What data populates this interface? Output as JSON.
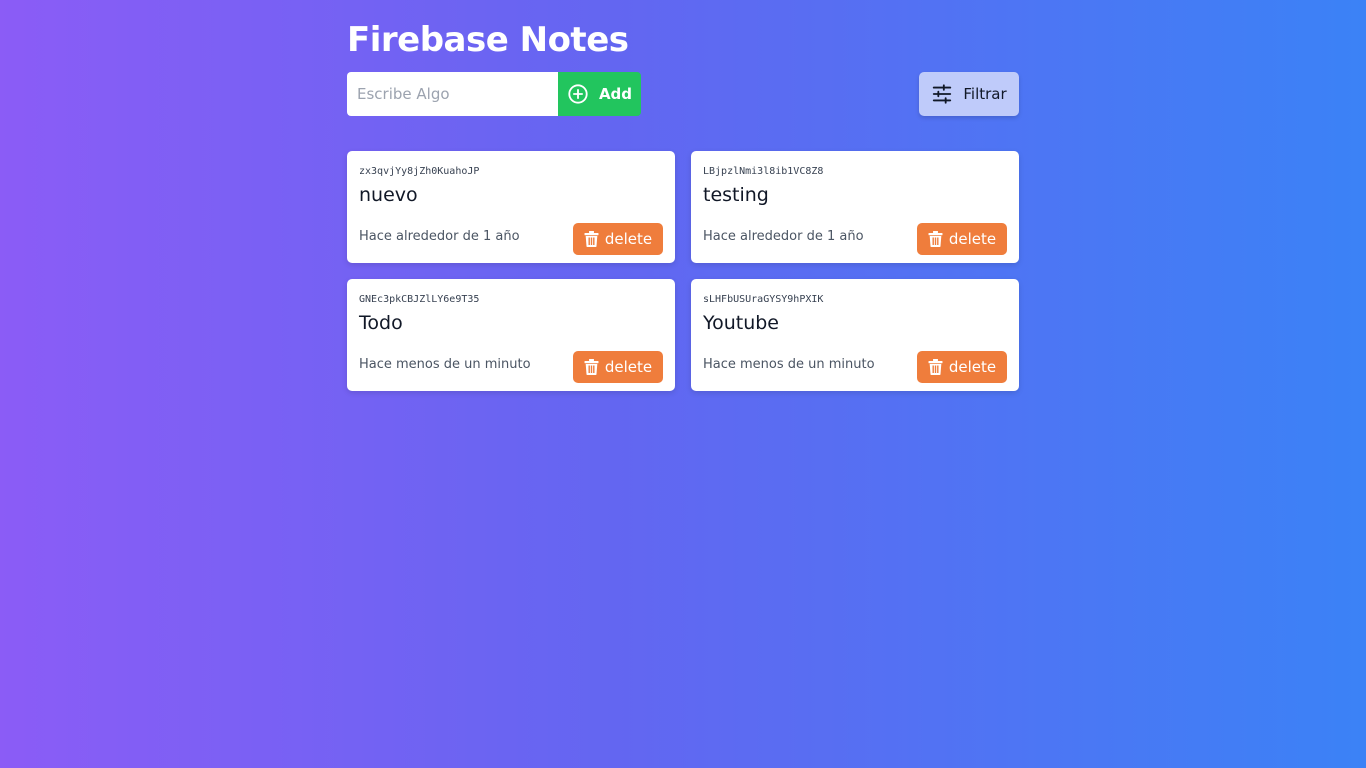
{
  "header": {
    "title": "Firebase Notes"
  },
  "form": {
    "input_placeholder": "Escribe Algo",
    "input_value": "",
    "add_label": "Add",
    "add_icon": "plus-circle-icon"
  },
  "filter": {
    "label": "Filtrar",
    "icon": "sliders-icon"
  },
  "notes": [
    {
      "id": "zx3qvjYy8jZh0KuahoJP",
      "text": "nuevo",
      "time": "Hace alrededor de 1 año",
      "delete_label": "delete"
    },
    {
      "id": "LBjpzlNmi3l8ib1VC8Z8",
      "text": "testing",
      "time": "Hace alrededor de 1 año",
      "delete_label": "delete"
    },
    {
      "id": "GNEc3pkCBJZlLY6e9T35",
      "text": "Todo",
      "time": "Hace menos de un minuto",
      "delete_label": "delete"
    },
    {
      "id": "sLHFbUSUraGYSY9hPXIK",
      "text": "Youtube",
      "time": "Hace menos de un minuto",
      "delete_label": "delete"
    }
  ],
  "colors": {
    "background_start": "#8b5cf6",
    "background_end": "#3b82f6",
    "add_button": "#22c55e",
    "filter_button": "#bfcbfa",
    "delete_button": "#ef7d3c"
  }
}
